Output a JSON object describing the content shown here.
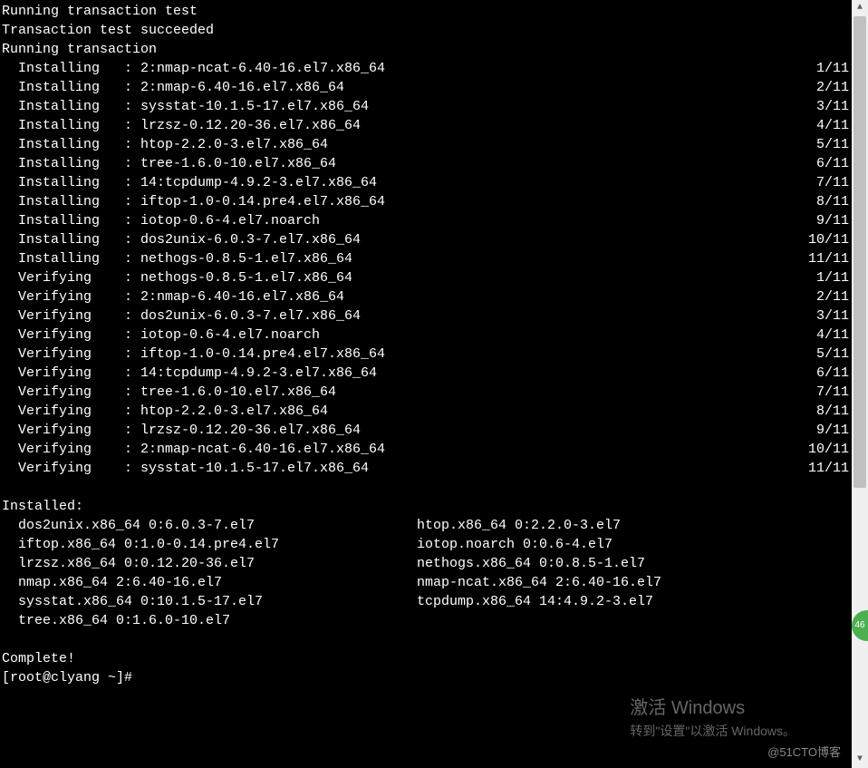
{
  "header": {
    "line1": "Running transaction test",
    "line2": "Transaction test succeeded",
    "line3": "Running transaction"
  },
  "actions": [
    {
      "label": "Installing",
      "pkg": "2:nmap-ncat-6.40-16.el7.x86_64",
      "count": "1/11"
    },
    {
      "label": "Installing",
      "pkg": "2:nmap-6.40-16.el7.x86_64",
      "count": "2/11"
    },
    {
      "label": "Installing",
      "pkg": "sysstat-10.1.5-17.el7.x86_64",
      "count": "3/11"
    },
    {
      "label": "Installing",
      "pkg": "lrzsz-0.12.20-36.el7.x86_64",
      "count": "4/11"
    },
    {
      "label": "Installing",
      "pkg": "htop-2.2.0-3.el7.x86_64",
      "count": "5/11"
    },
    {
      "label": "Installing",
      "pkg": "tree-1.6.0-10.el7.x86_64",
      "count": "6/11"
    },
    {
      "label": "Installing",
      "pkg": "14:tcpdump-4.9.2-3.el7.x86_64",
      "count": "7/11"
    },
    {
      "label": "Installing",
      "pkg": "iftop-1.0-0.14.pre4.el7.x86_64",
      "count": "8/11"
    },
    {
      "label": "Installing",
      "pkg": "iotop-0.6-4.el7.noarch",
      "count": "9/11"
    },
    {
      "label": "Installing",
      "pkg": "dos2unix-6.0.3-7.el7.x86_64",
      "count": "10/11"
    },
    {
      "label": "Installing",
      "pkg": "nethogs-0.8.5-1.el7.x86_64",
      "count": "11/11"
    },
    {
      "label": "Verifying",
      "pkg": "nethogs-0.8.5-1.el7.x86_64",
      "count": "1/11"
    },
    {
      "label": "Verifying",
      "pkg": "2:nmap-6.40-16.el7.x86_64",
      "count": "2/11"
    },
    {
      "label": "Verifying",
      "pkg": "dos2unix-6.0.3-7.el7.x86_64",
      "count": "3/11"
    },
    {
      "label": "Verifying",
      "pkg": "iotop-0.6-4.el7.noarch",
      "count": "4/11"
    },
    {
      "label": "Verifying",
      "pkg": "iftop-1.0-0.14.pre4.el7.x86_64",
      "count": "5/11"
    },
    {
      "label": "Verifying",
      "pkg": "14:tcpdump-4.9.2-3.el7.x86_64",
      "count": "6/11"
    },
    {
      "label": "Verifying",
      "pkg": "tree-1.6.0-10.el7.x86_64",
      "count": "7/11"
    },
    {
      "label": "Verifying",
      "pkg": "htop-2.2.0-3.el7.x86_64",
      "count": "8/11"
    },
    {
      "label": "Verifying",
      "pkg": "lrzsz-0.12.20-36.el7.x86_64",
      "count": "9/11"
    },
    {
      "label": "Verifying",
      "pkg": "2:nmap-ncat-6.40-16.el7.x86_64",
      "count": "10/11"
    },
    {
      "label": "Verifying",
      "pkg": "sysstat-10.1.5-17.el7.x86_64",
      "count": "11/11"
    }
  ],
  "installed_header": "Installed:",
  "installed": [
    {
      "l": "dos2unix.x86_64 0:6.0.3-7.el7",
      "r": "htop.x86_64 0:2.2.0-3.el7"
    },
    {
      "l": "iftop.x86_64 0:1.0-0.14.pre4.el7",
      "r": "iotop.noarch 0:0.6-4.el7"
    },
    {
      "l": "lrzsz.x86_64 0:0.12.20-36.el7",
      "r": "nethogs.x86_64 0:0.8.5-1.el7"
    },
    {
      "l": "nmap.x86_64 2:6.40-16.el7",
      "r": "nmap-ncat.x86_64 2:6.40-16.el7"
    },
    {
      "l": "sysstat.x86_64 0:10.1.5-17.el7",
      "r": "tcpdump.x86_64 14:4.9.2-3.el7"
    },
    {
      "l": "tree.x86_64 0:1.6.0-10.el7",
      "r": ""
    }
  ],
  "complete": "Complete!",
  "prompt": "[root@clyang ~]# ",
  "watermark": {
    "title": "激活 Windows",
    "sub": "转到\"设置\"以激活 Windows。"
  },
  "blog": "@51CTO博客",
  "badge": "46"
}
